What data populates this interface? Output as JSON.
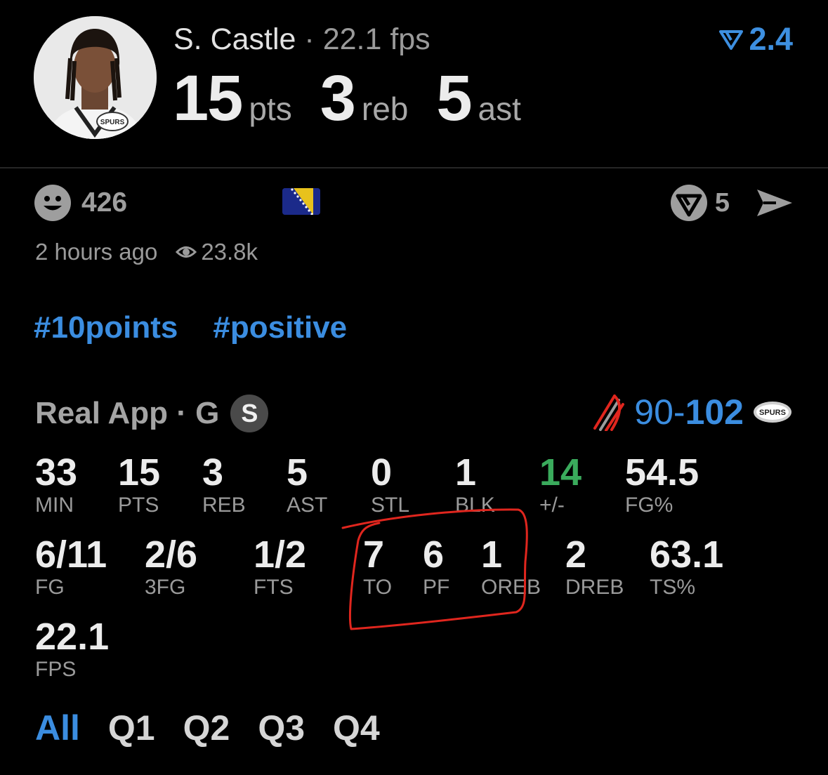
{
  "player": {
    "name": "S. Castle",
    "fps_label": "· 22.1 fps",
    "rating": "2.4",
    "pts": "15",
    "pts_unit": "pts",
    "reb": "3",
    "reb_unit": "reb",
    "ast": "5",
    "ast_unit": "ast",
    "logo_text": "SPURS"
  },
  "post": {
    "reaction_count": "426",
    "share_count": "5",
    "time": "2 hours ago",
    "views": "23.8k",
    "tags": [
      "#10points",
      "#positive"
    ]
  },
  "game": {
    "source": "Real App · G",
    "badge": "S",
    "score_away": "90-",
    "score_home": "102",
    "home_logo_text": "SPURS"
  },
  "stats": [
    {
      "value": "33",
      "label": "MIN"
    },
    {
      "value": "15",
      "label": "PTS"
    },
    {
      "value": "3",
      "label": "REB"
    },
    {
      "value": "5",
      "label": "AST"
    },
    {
      "value": "0",
      "label": "STL"
    },
    {
      "value": "1",
      "label": "BLK"
    },
    {
      "value": "14",
      "label": "+/-"
    },
    {
      "value": "54.5",
      "label": "FG%"
    },
    {
      "value": "6/11",
      "label": "FG"
    },
    {
      "value": "2/6",
      "label": "3FG"
    },
    {
      "value": "1/2",
      "label": "FTS"
    },
    {
      "value": "7",
      "label": "TO"
    },
    {
      "value": "6",
      "label": "PF"
    },
    {
      "value": "1",
      "label": "OREB"
    },
    {
      "value": "2",
      "label": "DREB"
    },
    {
      "value": "63.1",
      "label": "TS%"
    },
    {
      "value": "22.1",
      "label": "FPS"
    }
  ],
  "quarters": [
    "All",
    "Q1",
    "Q2",
    "Q3",
    "Q4"
  ],
  "colors": {
    "accent": "#3b8de0",
    "positive": "#3aab5c",
    "annotation": "#e0261e",
    "background": "#000000"
  }
}
